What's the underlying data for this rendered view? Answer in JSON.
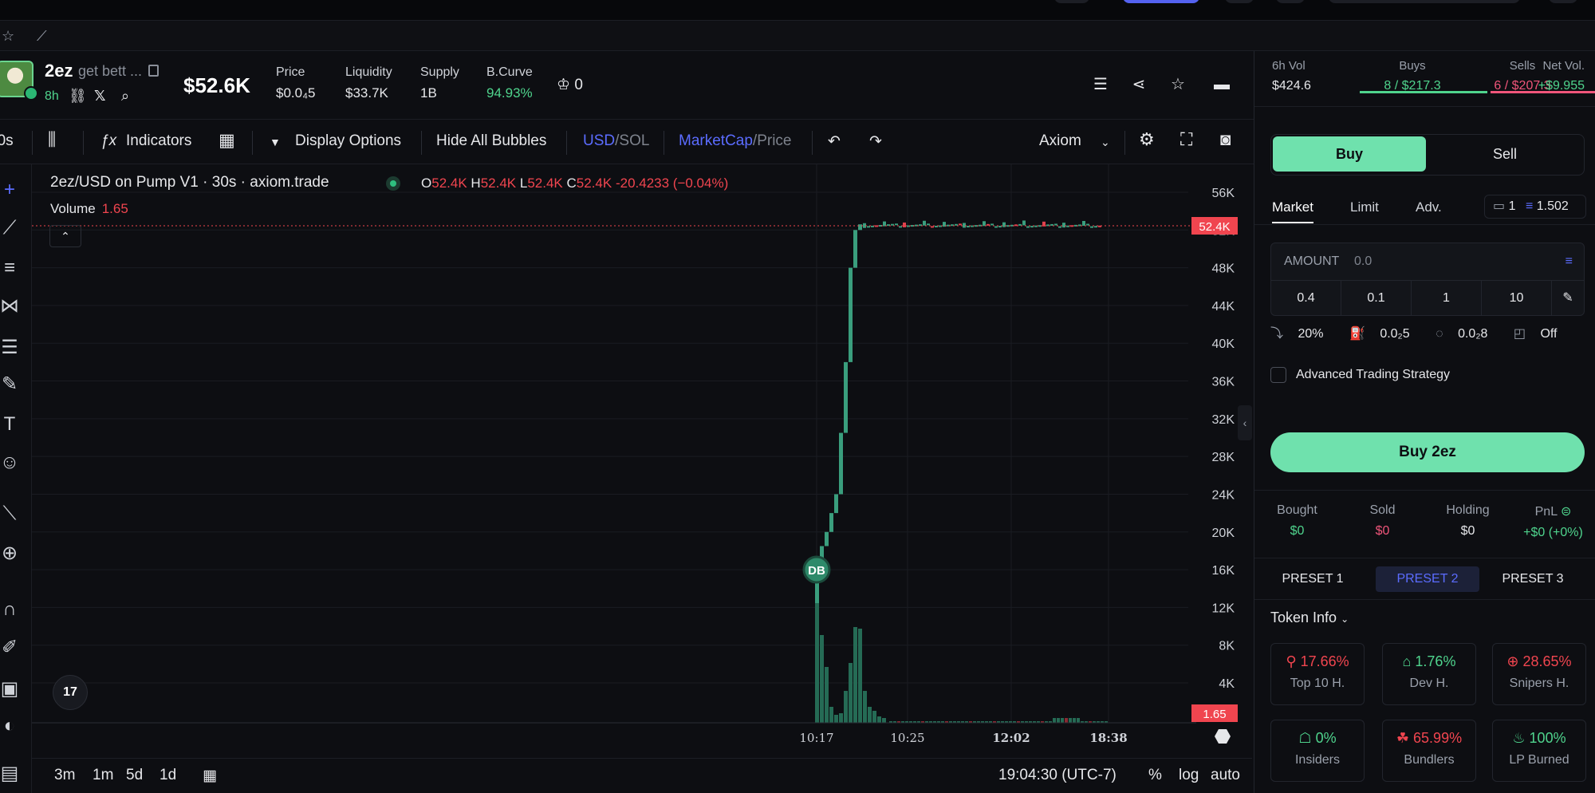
{
  "header": {
    "symbol": "2ez",
    "name": "get bett ...",
    "age": "8h",
    "market_cap": "$52.6K",
    "stats": [
      {
        "label": "Price",
        "value": "$0.0₄5"
      },
      {
        "label": "Liquidity",
        "value": "$33.7K"
      },
      {
        "label": "Supply",
        "value": "1B"
      },
      {
        "label": "B.Curve",
        "value": "94.93%"
      }
    ],
    "holders_count": "0"
  },
  "toolbar": {
    "interval": "30s",
    "indicators": "Indicators",
    "display_options": "Display Options",
    "hide_bubbles": "Hide All Bubbles",
    "currency_a": "USD",
    "currency_b": "SOL",
    "mode_a": "MarketCap",
    "mode_b": "Price",
    "source": "Axiom"
  },
  "chart": {
    "title": "2ez/USD on Pump V1 · 30s · axiom.trade",
    "ohlc": {
      "o": "52.4K",
      "h": "52.4K",
      "l": "52.4K",
      "c": "52.4K",
      "change": "-20.4233 (−0.04%)"
    },
    "volume_label": "Volume",
    "volume_value": "1.65",
    "price_tag": "52.4K",
    "volume_tag": "1.65",
    "bubble": "DB",
    "tv_logo": "17"
  },
  "chart_data": {
    "type": "candlestick",
    "y_ticks": [
      "56K",
      "52K",
      "48K",
      "44K",
      "40K",
      "36K",
      "32K",
      "28K",
      "24K",
      "20K",
      "16K",
      "12K",
      "8K",
      "4K"
    ],
    "x_ticks": [
      "10:17",
      "10:25",
      "12:02",
      "18:38"
    ],
    "ylim": [
      0,
      58000
    ],
    "last_price": 52400
  },
  "bottom": {
    "ranges": [
      "3m",
      "1m",
      "5d",
      "1d"
    ],
    "clock": "19:04:30 (UTC-7)",
    "pct": "%",
    "log": "log",
    "auto": "auto"
  },
  "panel": {
    "vol": {
      "label": "6h Vol",
      "value": "$424.6"
    },
    "buys": {
      "label": "Buys",
      "count": "8",
      "value": "$217.3"
    },
    "sells": {
      "label": "Sells",
      "count": "6",
      "value": "$207.3"
    },
    "net": {
      "label": "Net Vol.",
      "value": "+$9.955"
    },
    "buy_tab": "Buy",
    "sell_tab": "Sell",
    "order_tabs": [
      "Market",
      "Limit",
      "Adv."
    ],
    "wallet_count": "1",
    "wallet_balance": "1.502",
    "amount_label": "AMOUNT",
    "amount_placeholder": "0.0",
    "quick_amounts": [
      "0.4",
      "0.1",
      "1",
      "10"
    ],
    "settings": [
      "20%",
      "0.0₂5",
      "0.0₂8",
      "Off"
    ],
    "advanced": "Advanced Trading Strategy",
    "buy_button": "Buy 2ez",
    "position": [
      {
        "label": "Bought",
        "value": "$0"
      },
      {
        "label": "Sold",
        "value": "$0"
      },
      {
        "label": "Holding",
        "value": "$0"
      },
      {
        "label": "PnL",
        "value": "+$0 (+0%)"
      }
    ],
    "presets": [
      "PRESET 1",
      "PRESET 2",
      "PRESET 3"
    ],
    "token_info": "Token Info",
    "cards": [
      {
        "value": "17.66%",
        "label": "Top 10 H.",
        "color": "#f0454f"
      },
      {
        "value": "1.76%",
        "label": "Dev H.",
        "color": "#4fd48d"
      },
      {
        "value": "28.65%",
        "label": "Snipers H.",
        "color": "#f0454f"
      },
      {
        "value": "0%",
        "label": "Insiders",
        "color": "#4fd48d"
      },
      {
        "value": "65.99%",
        "label": "Bundlers",
        "color": "#f0454f"
      },
      {
        "value": "100%",
        "label": "LP Burned",
        "color": "#4fd48d"
      }
    ]
  }
}
